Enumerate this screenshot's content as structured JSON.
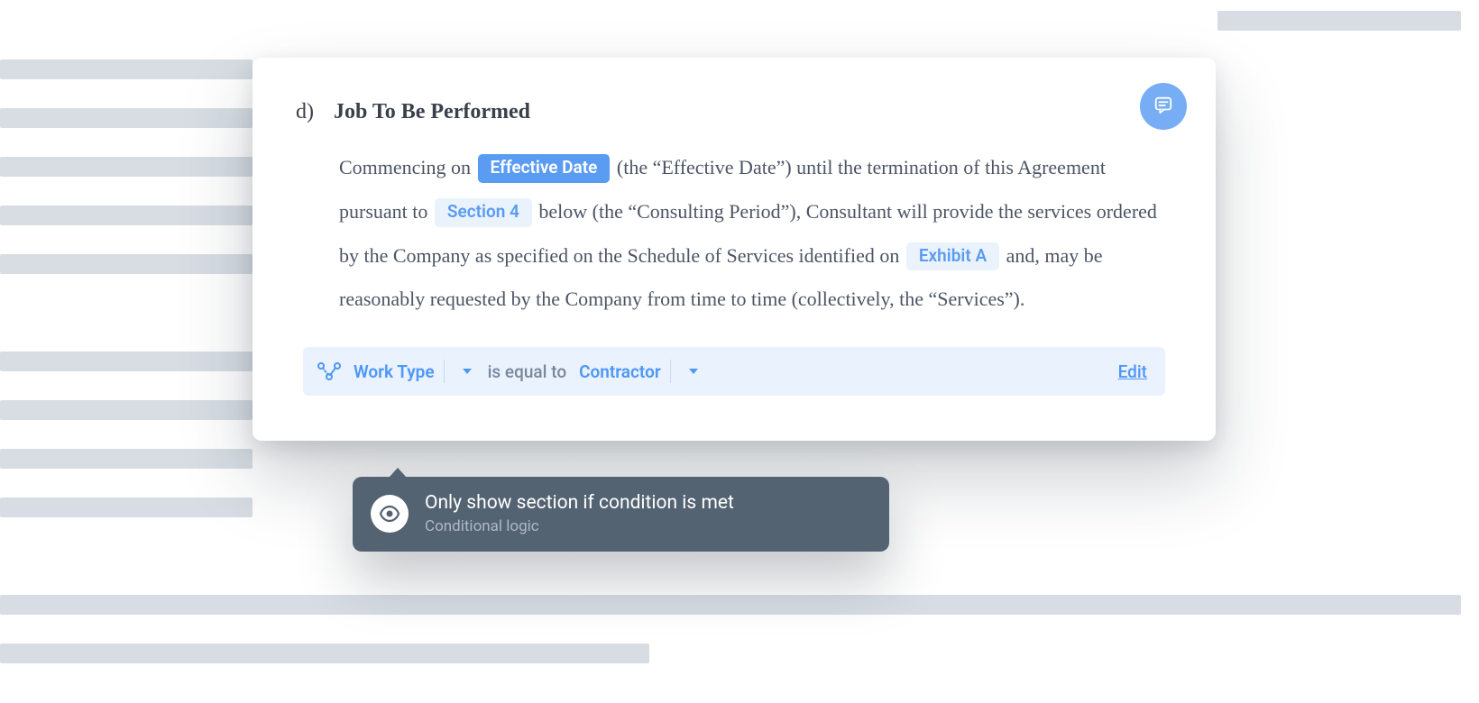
{
  "section": {
    "marker": "d)",
    "title": "Job To Be Performed",
    "body_parts": [
      "Commencing on ",
      " (the “Effective Date”) until the termination of this Agreement pursuant to ",
      " below (the “Consulting Period”), Consultant will provide the services ordered by the Company as specified on the Schedule of Services identified on ",
      " and, may be reasonably requested by the Company from time to time (collectively, the “Services”)."
    ],
    "fields": {
      "effective_date": "Effective Date",
      "section4": "Section 4",
      "exhibit_a": "Exhibit A"
    }
  },
  "condition": {
    "field": "Work Type",
    "operator": "is equal to",
    "value": "Contractor",
    "edit": "Edit"
  },
  "tooltip": {
    "title": "Only show section if condition is met",
    "subtitle": "Conditional logic"
  }
}
